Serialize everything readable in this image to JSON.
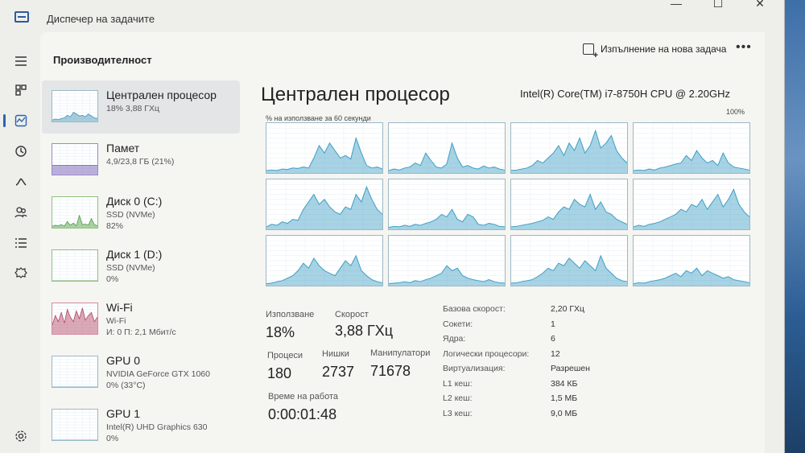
{
  "window": {
    "title": "Диспечер на задачите",
    "controls": [
      "—",
      "☐",
      "✕"
    ]
  },
  "nav": {
    "icons": [
      "hamburger-icon",
      "processes-icon",
      "performance-icon",
      "app-history-icon",
      "startup-icon",
      "users-icon",
      "details-icon",
      "services-icon",
      "settings-icon"
    ]
  },
  "header": {
    "section": "Производителност",
    "run_task": "Изпълнение на нова задача",
    "more": "•••"
  },
  "resources": [
    {
      "name": "Централен процесор",
      "sub": "18% 3,88 ГХц",
      "sub2": "",
      "color": "#3b8fb5"
    },
    {
      "name": "Памет",
      "sub": "4,9/23,8 ГБ (21%)",
      "sub2": "",
      "color": "#6a4fb0"
    },
    {
      "name": "Диск 0 (C:)",
      "sub": "SSD (NVMe)",
      "sub2": "82%",
      "color": "#4a9a3a"
    },
    {
      "name": "Диск 1 (D:)",
      "sub": "SSD (NVMe)",
      "sub2": "0%",
      "color": "#4a9a3a"
    },
    {
      "name": "Wi-Fi",
      "sub": "Wi-Fi",
      "sub2": "И: 0 П: 2,1 Мбит/с",
      "color": "#b04060"
    },
    {
      "name": "GPU 0",
      "sub": "NVIDIA GeForce GTX 1060",
      "sub2": "0% (33°C)",
      "color": "#3b8fb5"
    },
    {
      "name": "GPU 1",
      "sub": "Intel(R) UHD Graphics 630",
      "sub2": "0%",
      "color": "#3b8fb5"
    }
  ],
  "cpu": {
    "title": "Централен процесор",
    "model": "Intel(R) Core(TM) i7-8750H CPU @ 2.20GHz",
    "util_label": "% на използване за 60 секунди",
    "util_max": "100%",
    "accent": "#3b9dc4",
    "stats": {
      "usage_label": "Използване",
      "usage": "18%",
      "speed_label": "Скорост",
      "speed": "3,88 ГХц",
      "processes_label": "Процеси",
      "processes": "180",
      "threads_label": "Нишки",
      "threads": "2737",
      "handles_label": "Манипулатори",
      "handles": "71678",
      "uptime_label": "Време на работа",
      "uptime": "0:00:01:48"
    },
    "specs": [
      {
        "key": "Базова скорост:",
        "value": "2,20 ГХц"
      },
      {
        "key": "Сокети:",
        "value": "1"
      },
      {
        "key": "Ядра:",
        "value": "6"
      },
      {
        "key": "Логически процесори:",
        "value": "12"
      },
      {
        "key": "Виртуализация:",
        "value": "Разрешен"
      },
      {
        "key": "L1 кеш:",
        "value": "384 КБ"
      },
      {
        "key": "L2 кеш:",
        "value": "1,5 МБ"
      },
      {
        "key": "L3 кеш:",
        "value": "9,0 МБ"
      }
    ],
    "core_graphs": [
      [
        5,
        6,
        5,
        8,
        7,
        10,
        9,
        12,
        10,
        30,
        55,
        40,
        60,
        45,
        30,
        35,
        28,
        70,
        40,
        15,
        10,
        12,
        8
      ],
      [
        5,
        8,
        6,
        10,
        12,
        20,
        15,
        40,
        25,
        12,
        10,
        18,
        60,
        30,
        12,
        15,
        10,
        8,
        14,
        10,
        12,
        8,
        6
      ],
      [
        5,
        6,
        8,
        10,
        15,
        25,
        20,
        30,
        40,
        55,
        35,
        60,
        45,
        70,
        40,
        55,
        85,
        50,
        60,
        75,
        45,
        30,
        20
      ],
      [
        5,
        6,
        5,
        8,
        6,
        10,
        12,
        15,
        18,
        20,
        35,
        25,
        45,
        30,
        20,
        25,
        15,
        40,
        20,
        12,
        10,
        8,
        6
      ],
      [
        5,
        10,
        8,
        15,
        12,
        20,
        18,
        40,
        55,
        70,
        50,
        60,
        45,
        35,
        30,
        45,
        40,
        70,
        55,
        85,
        60,
        40,
        30
      ],
      [
        4,
        6,
        5,
        8,
        6,
        10,
        8,
        12,
        15,
        20,
        30,
        25,
        40,
        20,
        15,
        30,
        25,
        10,
        8,
        12,
        10,
        6,
        5
      ],
      [
        5,
        6,
        8,
        10,
        12,
        15,
        18,
        25,
        20,
        35,
        45,
        40,
        60,
        50,
        45,
        70,
        40,
        55,
        35,
        30,
        20,
        15,
        10
      ],
      [
        5,
        8,
        6,
        10,
        12,
        15,
        20,
        25,
        30,
        40,
        35,
        50,
        45,
        60,
        40,
        55,
        70,
        45,
        60,
        80,
        50,
        35,
        25
      ],
      [
        4,
        5,
        8,
        10,
        15,
        20,
        30,
        45,
        35,
        55,
        40,
        30,
        25,
        20,
        35,
        50,
        40,
        60,
        30,
        20,
        12,
        8,
        6
      ],
      [
        4,
        5,
        6,
        8,
        6,
        10,
        8,
        12,
        15,
        20,
        25,
        40,
        30,
        35,
        20,
        15,
        12,
        10,
        8,
        12,
        8,
        6,
        5
      ],
      [
        5,
        6,
        8,
        10,
        12,
        18,
        25,
        35,
        30,
        45,
        40,
        55,
        45,
        35,
        50,
        40,
        30,
        60,
        35,
        25,
        15,
        10,
        8
      ],
      [
        4,
        6,
        5,
        8,
        10,
        12,
        15,
        20,
        25,
        18,
        30,
        25,
        35,
        20,
        30,
        25,
        20,
        15,
        18,
        12,
        10,
        8,
        6
      ]
    ],
    "thumb_graphs": [
      [
        5,
        8,
        6,
        10,
        12,
        20,
        15,
        30,
        25,
        18,
        20,
        15,
        25,
        18,
        12,
        10
      ],
      [
        30,
        30,
        30,
        30,
        30,
        30,
        30,
        30,
        30,
        30,
        30,
        30,
        30,
        30,
        30,
        30
      ],
      [
        5,
        8,
        6,
        10,
        5,
        20,
        8,
        15,
        6,
        40,
        10,
        12,
        8,
        30,
        10,
        6
      ],
      [
        0,
        0,
        0,
        0,
        0,
        0,
        0,
        0,
        0,
        0,
        0,
        0,
        0,
        0,
        0,
        0
      ],
      [
        30,
        60,
        40,
        70,
        35,
        80,
        55,
        40,
        75,
        50,
        85,
        45,
        60,
        70,
        40,
        55
      ],
      [
        0,
        0,
        0,
        0,
        0,
        0,
        0,
        0,
        0,
        0,
        0,
        0,
        0,
        0,
        0,
        0
      ],
      [
        0,
        0,
        0,
        0,
        0,
        0,
        0,
        0,
        0,
        0,
        0,
        0,
        0,
        0,
        0,
        0
      ]
    ]
  }
}
